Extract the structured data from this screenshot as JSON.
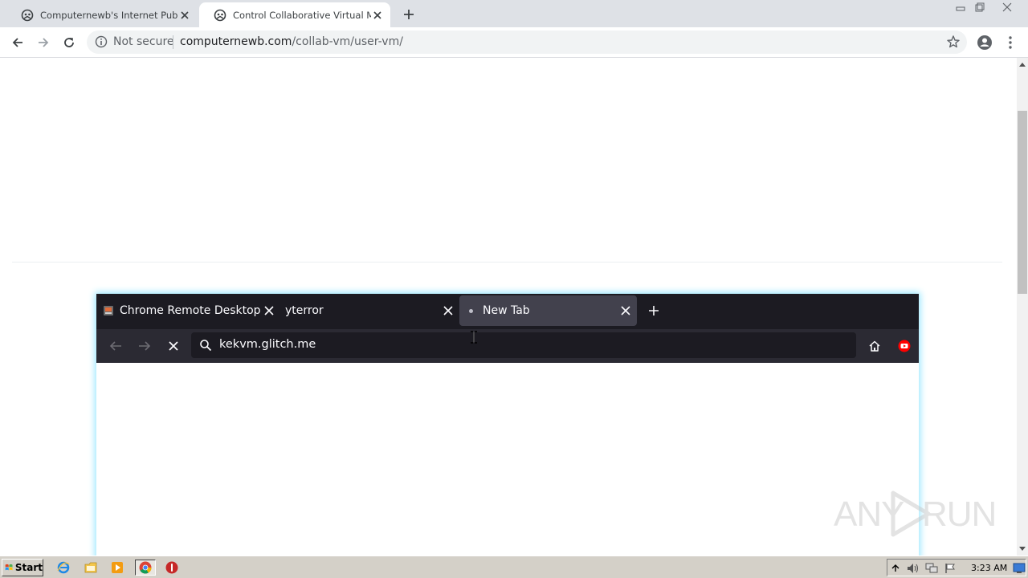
{
  "browser": {
    "tabs": [
      {
        "title": "Computernewb's Internet Pub Hub",
        "icon": "computernewb-logo-icon",
        "active": false
      },
      {
        "title": "Control Collaborative Virtual Machine",
        "icon": "computernewb-logo-icon",
        "active": true
      }
    ],
    "omnibox": {
      "security_label": "Not secure",
      "url_host": "computernewb.com",
      "url_path": "/collab-vm/user-vm/"
    }
  },
  "vm": {
    "tabs": [
      {
        "title": "Chrome Remote Desktop",
        "active": false
      },
      {
        "title": "yterror",
        "active": false
      },
      {
        "title": "New Tab",
        "active": true
      }
    ],
    "url": "kekvm.glitch.me"
  },
  "taskbar": {
    "start_label": "Start",
    "clock": "3:23 AM"
  },
  "watermark": {
    "text_left": "ANY",
    "text_right": "RUN"
  },
  "colors": {
    "vm_glow": "#9be8ff",
    "vm_tabbar": "#1c1b22",
    "vm_navbar": "#2b2a33",
    "youtube_red": "#ff0000"
  }
}
